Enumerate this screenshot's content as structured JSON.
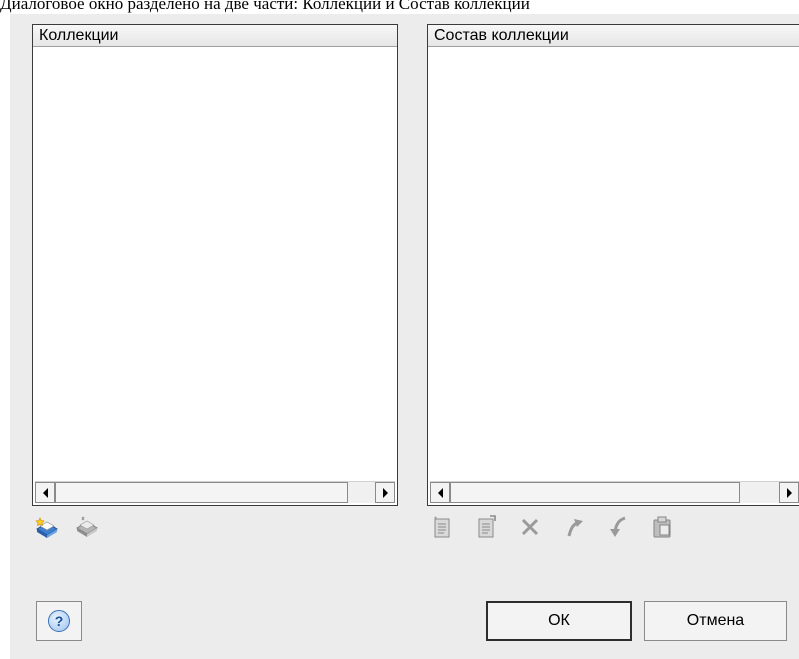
{
  "caption": "Диалоговое окно разделено на две части: Коллекции и Состав коллекции",
  "left_panel": {
    "header": "Коллекции"
  },
  "right_panel": {
    "header": "Состав коллекции"
  },
  "left_toolbar": {
    "icons": [
      "new-collection-icon",
      "delete-collection-icon"
    ]
  },
  "right_toolbar": {
    "icons": [
      "add-item-icon",
      "edit-item-icon",
      "delete-item-icon",
      "move-up-icon",
      "move-down-icon",
      "paste-icon"
    ]
  },
  "buttons": {
    "help": "?",
    "ok": "ОК",
    "cancel": "Отмена"
  },
  "colors": {
    "dialog_bg": "#ececec",
    "panel_bg": "#ffffff",
    "disabled_icon": "#9a9a9a",
    "help_blue": "#1b4f9a"
  }
}
